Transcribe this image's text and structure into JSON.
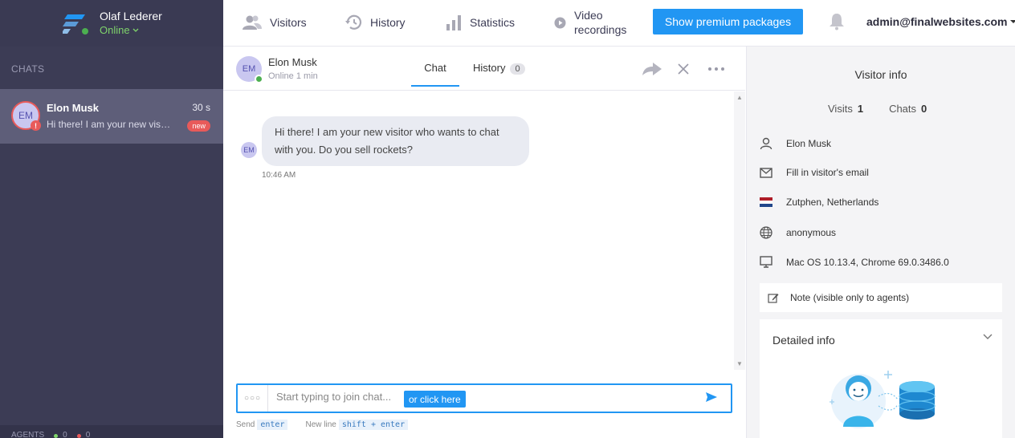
{
  "agent": {
    "name": "Olaf Lederer",
    "status": "Online"
  },
  "sidebar": {
    "chats_label": "CHATS",
    "chat_item": {
      "initials": "EM",
      "alert": "!",
      "name": "Elon Musk",
      "time": "30 s",
      "preview": "Hi there! I am your new visitor who wants to chat with you. Do you sell rockets?",
      "badge": "new"
    },
    "agents_label": "AGENTS",
    "agents_online": "0",
    "agents_offline": "0"
  },
  "topnav": {
    "visitors": "Visitors",
    "history": "History",
    "statistics": "Statistics",
    "video_line1": "Video",
    "video_line2": "recordings",
    "premium_button": "Show premium packages",
    "account": "admin@finalwebsites.com"
  },
  "chat": {
    "visitor_initials": "EM",
    "visitor_name": "Elon Musk",
    "visitor_status": "Online 1 min",
    "tab_chat": "Chat",
    "tab_history": "History",
    "history_count": "0",
    "message": "Hi there! I am your new visitor who wants to chat with you. Do you sell rockets?",
    "message_time": "10:46 AM",
    "composer_placeholder": "Start typing to join chat...",
    "composer_click": "or click here",
    "hint_send_label": "Send",
    "hint_send_key": "enter",
    "hint_newline_label": "New line",
    "hint_newline_key": "shift + enter"
  },
  "visitor_info": {
    "title": "Visitor info",
    "visits_label": "Visits",
    "visits_value": "1",
    "chats_label": "Chats",
    "chats_value": "0",
    "name": "Elon Musk",
    "email": "Fill in visitor's email",
    "location": "Zutphen, Netherlands",
    "identity": "anonymous",
    "system": "Mac OS 10.13.4, Chrome 69.0.3486.0",
    "note": "Note (visible only to agents)",
    "detailed_info": "Detailed info"
  },
  "colors": {
    "sidebar": "#3c3c55",
    "accent": "#2196f3",
    "online": "#4caf50",
    "alert": "#e85a5a"
  }
}
